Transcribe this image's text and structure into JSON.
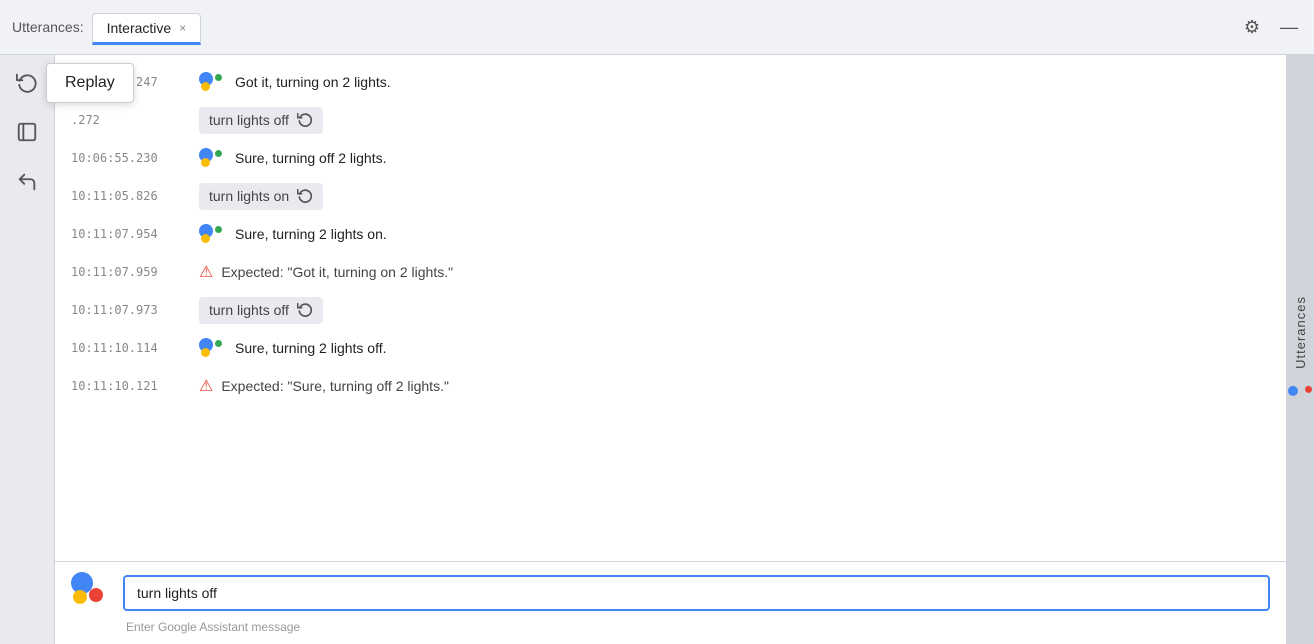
{
  "titleBar": {
    "label": "Utterances:",
    "tab": {
      "label": "Interactive",
      "closeLabel": "×"
    },
    "settingsIcon": "⚙",
    "minimizeIcon": "—"
  },
  "sidebar": {
    "replayIcon": "↺",
    "saveIcon": "⊟",
    "undoIcon": "↩",
    "tooltip": "Replay"
  },
  "messages": [
    {
      "id": "msg1",
      "type": "assistant",
      "timestamp": "10:04:36.247",
      "text": "Got it, turning on 2 lights."
    },
    {
      "id": "msg2",
      "type": "user-query",
      "timestamp": ".272",
      "queryText": "turn lights off"
    },
    {
      "id": "msg3",
      "type": "assistant",
      "timestamp": "10:06:55.230",
      "text": "Sure, turning off 2 lights."
    },
    {
      "id": "msg4",
      "type": "user-query",
      "timestamp": "10:11:05.826",
      "queryText": "turn lights on"
    },
    {
      "id": "msg5",
      "type": "assistant",
      "timestamp": "10:11:07.954",
      "text": "Sure, turning 2 lights on."
    },
    {
      "id": "msg6",
      "type": "error",
      "timestamp": "10:11:07.959",
      "text": "Expected: \"Got it, turning on 2 lights.\""
    },
    {
      "id": "msg7",
      "type": "user-query",
      "timestamp": "10:11:07.973",
      "queryText": "turn lights off"
    },
    {
      "id": "msg8",
      "type": "assistant",
      "timestamp": "10:11:10.114",
      "text": "Sure, turning 2 lights off."
    },
    {
      "id": "msg9",
      "type": "error",
      "timestamp": "10:11:10.121",
      "text": "Expected: \"Sure, turning off 2 lights.\""
    }
  ],
  "inputArea": {
    "value": "turn lights off",
    "placeholder": "Enter Google Assistant message",
    "hint": "Enter Google Assistant message"
  },
  "rightSidebar": {
    "label": "Utterances"
  }
}
